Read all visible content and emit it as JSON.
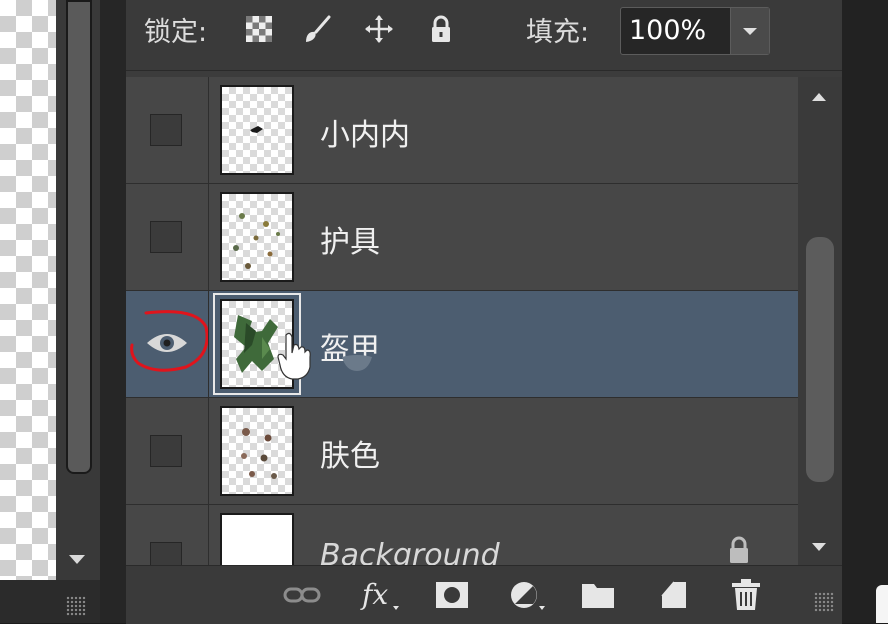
{
  "lock_bar": {
    "lock_label": "锁定:",
    "lock_icons": [
      "lock-transparent-pixels-icon",
      "lock-image-pixels-icon",
      "lock-position-icon",
      "lock-all-icon"
    ],
    "fill_label": "填充:",
    "fill_value": "100%",
    "fill_dropdown_icon": "chevron-down-icon"
  },
  "layers": [
    {
      "name": "小内内",
      "visible": false,
      "selected": false
    },
    {
      "name": "护具",
      "visible": false,
      "selected": false
    },
    {
      "name": "盔甲",
      "visible": true,
      "selected": true
    },
    {
      "name": "肤色",
      "visible": false,
      "selected": false
    },
    {
      "name": "Background",
      "visible": false,
      "selected": false,
      "locked": true
    }
  ],
  "footer_icons": [
    "link-layers-icon",
    "fx-icon",
    "add-mask-icon",
    "adjustment-layer-icon",
    "new-group-icon",
    "new-layer-icon",
    "trash-icon"
  ],
  "colors": {
    "panel_bg": "#3c3c3c",
    "row_bg": "#474747",
    "selected_row": "#4c5d70",
    "annotation": "#e0141c"
  }
}
